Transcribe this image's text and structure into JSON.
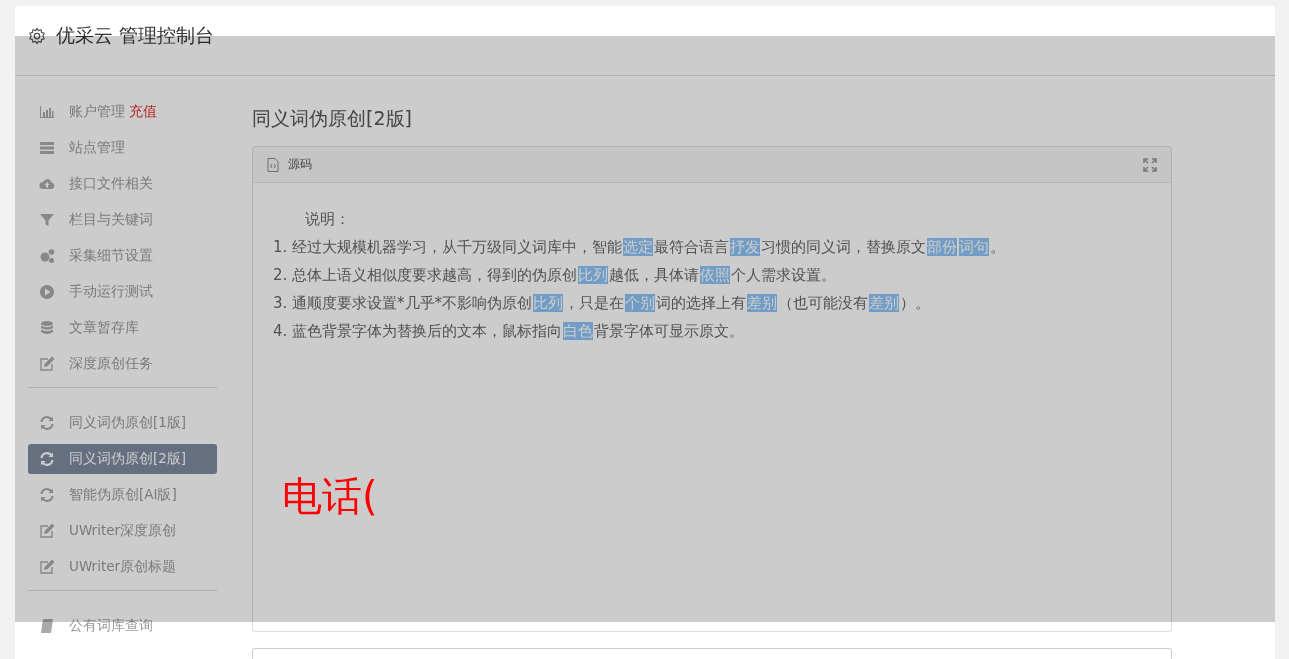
{
  "header": {
    "title": "优采云 管理控制台"
  },
  "sidebar": {
    "groups": [
      [
        {
          "label": "账户管理",
          "badge": "充值",
          "selected": false
        },
        {
          "label": "站点管理",
          "selected": false
        },
        {
          "label": "接口文件相关",
          "selected": false
        },
        {
          "label": "栏目与关键词",
          "selected": false
        },
        {
          "label": "采集细节设置",
          "selected": false
        },
        {
          "label": "手动运行测试",
          "selected": false
        },
        {
          "label": "文章暂存库",
          "selected": false
        },
        {
          "label": "深度原创任务",
          "selected": false
        }
      ],
      [
        {
          "label": "同义词伪原创[1版]",
          "selected": false
        },
        {
          "label": "同义词伪原创[2版]",
          "selected": true
        },
        {
          "label": "智能伪原创[AI版]",
          "selected": false
        },
        {
          "label": "UWriter深度原创",
          "selected": false
        },
        {
          "label": "UWriter原创标题",
          "selected": false
        }
      ],
      [
        {
          "label": "公有词库查询",
          "selected": false
        }
      ]
    ]
  },
  "main": {
    "title": "同义词伪原创[2版]",
    "card": {
      "title": "源码",
      "intro": "说明：",
      "lines": [
        [
          {
            "text": "1. 经过大规模机器学习，从千万级同义词库中，智能",
            "highlighted": false
          },
          {
            "text": "选定",
            "highlighted": true
          },
          {
            "text": "最符合语言",
            "highlighted": false
          },
          {
            "text": "抒发",
            "highlighted": true
          },
          {
            "text": "习惯的同义词，替换原文",
            "highlighted": false
          },
          {
            "text": "部份",
            "highlighted": true
          },
          {
            "text": "词句",
            "highlighted": true
          },
          {
            "text": "。",
            "highlighted": false
          }
        ],
        [
          {
            "text": "2. 总体上语义相似度要求越高，得到的伪原创",
            "highlighted": false
          },
          {
            "text": "比列",
            "highlighted": true
          },
          {
            "text": "越低，具体请",
            "highlighted": false
          },
          {
            "text": "依照",
            "highlighted": true
          },
          {
            "text": "个人需求设置。",
            "highlighted": false
          }
        ],
        [
          {
            "text": "3. 通顺度要求设置*几乎*不影响伪原创",
            "highlighted": false
          },
          {
            "text": "比列",
            "highlighted": true
          },
          {
            "text": "，只是在",
            "highlighted": false
          },
          {
            "text": "个别",
            "highlighted": true
          },
          {
            "text": "词的选择上有",
            "highlighted": false
          },
          {
            "text": "差别",
            "highlighted": true
          },
          {
            "text": "（也可能没有",
            "highlighted": false
          },
          {
            "text": "差别",
            "highlighted": true
          },
          {
            "text": "）。",
            "highlighted": false
          }
        ],
        [
          {
            "text": "4. 蓝色背景字体为替换后的文本，鼠标指向",
            "highlighted": false
          },
          {
            "text": "白色",
            "highlighted": true
          },
          {
            "text": "背景字体可显示原文。",
            "highlighted": false
          }
        ]
      ]
    }
  },
  "overlay": {
    "text": "电话("
  }
}
